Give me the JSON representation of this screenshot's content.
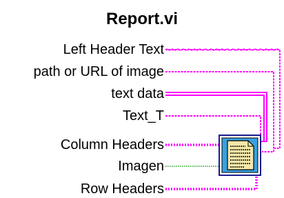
{
  "vi": {
    "title": "Report.vi",
    "icon": "report-document-icon"
  },
  "terminals": [
    {
      "label": "Left Header Text",
      "wire": "string",
      "color": "#ff00ff"
    },
    {
      "label": "path or URL of image",
      "wire": "string",
      "color": "#ff00ff"
    },
    {
      "label": "text data",
      "wire": "string-array-2d",
      "color": "#ff00ff"
    },
    {
      "label": "Text_T",
      "wire": "string",
      "color": "#ff00ff"
    },
    {
      "label": "Column Headers",
      "wire": "string-array",
      "color": "#ff00ff"
    },
    {
      "label": "Imagen",
      "wire": "numeric-dotted",
      "color": "#1a9a1a"
    },
    {
      "label": "Row Headers",
      "wire": "string-array",
      "color": "#ff00ff"
    }
  ]
}
